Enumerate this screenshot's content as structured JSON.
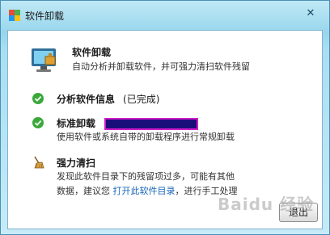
{
  "window": {
    "title": "软件卸载",
    "close_symbol": "✕"
  },
  "header": {
    "title": "软件卸载",
    "description": "自动分析并卸载软件，并可强力清扫软件残留",
    "icon": "computer-uninstall-icon"
  },
  "steps": [
    {
      "title": "分析软件信息",
      "status": "(已完成)",
      "icon": "check-icon"
    },
    {
      "title": "标准卸载",
      "description": "使用软件或系统自带的卸载程序进行常规卸载",
      "icon": "check-icon",
      "progress": 1.0
    },
    {
      "title": "强力清扫",
      "description_line1": "发现此软件目录下的残留项过多，可能有其他",
      "description_line2_pre": "数据，建议您",
      "description_link": "打开此软件目录",
      "description_line2_post": "，进行手工处理",
      "icon": "broom-icon"
    }
  ],
  "buttons": {
    "exit_label": "退出"
  },
  "watermark": "Baidu 经验",
  "colors": {
    "check_green": "#3aa83a",
    "link_blue": "#1565b7",
    "progress_fill": "#1a0f7a",
    "progress_border": "#d11cc8"
  }
}
